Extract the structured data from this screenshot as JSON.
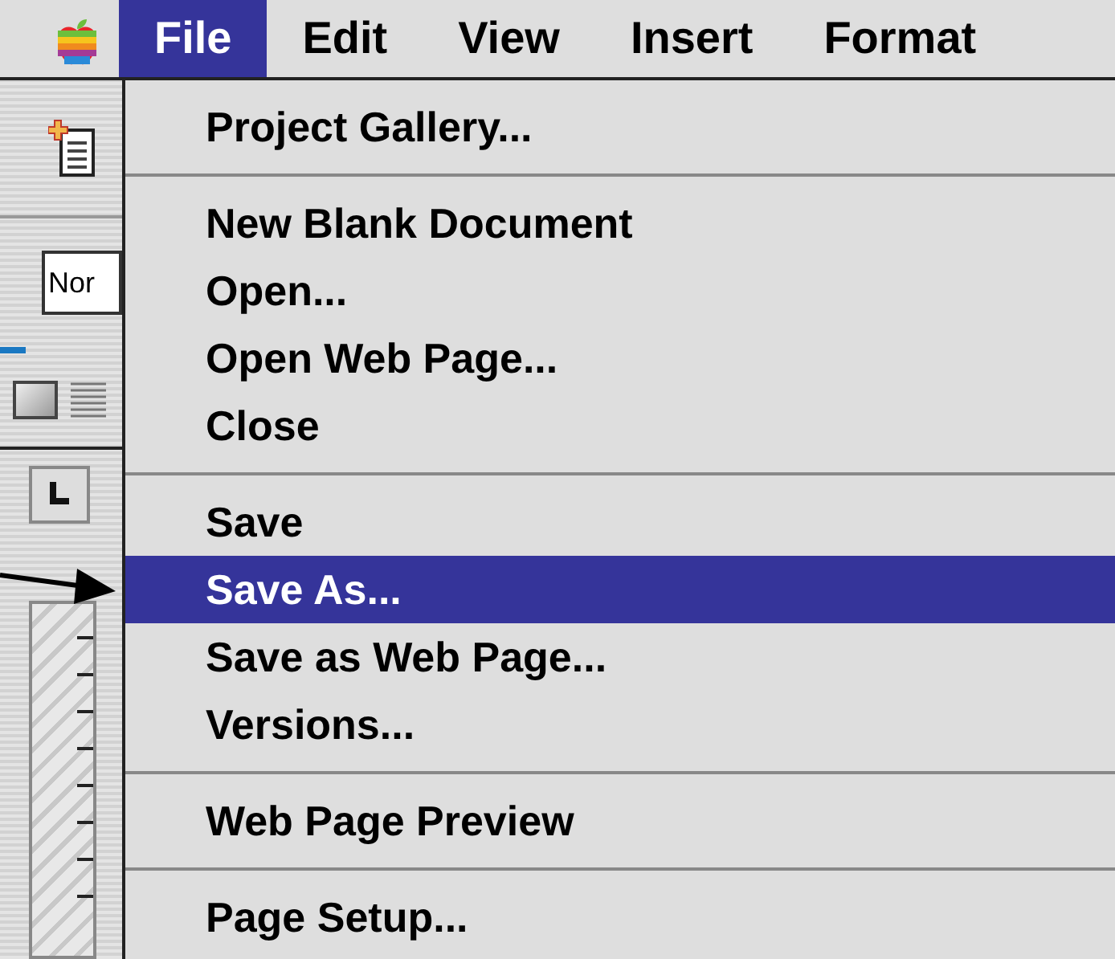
{
  "menu_bar": [
    {
      "label": "File",
      "selected": true
    },
    {
      "label": "Edit",
      "selected": false
    },
    {
      "label": "View",
      "selected": false
    },
    {
      "label": "Insert",
      "selected": false
    },
    {
      "label": "Format",
      "selected": false
    }
  ],
  "toolbar": {
    "style_field": "Nor"
  },
  "file_menu": {
    "sections": [
      [
        {
          "label": "Project Gallery...",
          "selected": false
        }
      ],
      [
        {
          "label": "New Blank Document",
          "selected": false
        },
        {
          "label": "Open...",
          "selected": false
        },
        {
          "label": "Open Web Page...",
          "selected": false
        },
        {
          "label": "Close",
          "selected": false
        }
      ],
      [
        {
          "label": "Save",
          "selected": false
        },
        {
          "label": "Save As...",
          "selected": true
        },
        {
          "label": "Save as Web Page...",
          "selected": false
        },
        {
          "label": "Versions...",
          "selected": false
        }
      ],
      [
        {
          "label": "Web Page Preview",
          "selected": false
        }
      ],
      [
        {
          "label": "Page Setup...",
          "selected": false
        }
      ]
    ]
  }
}
